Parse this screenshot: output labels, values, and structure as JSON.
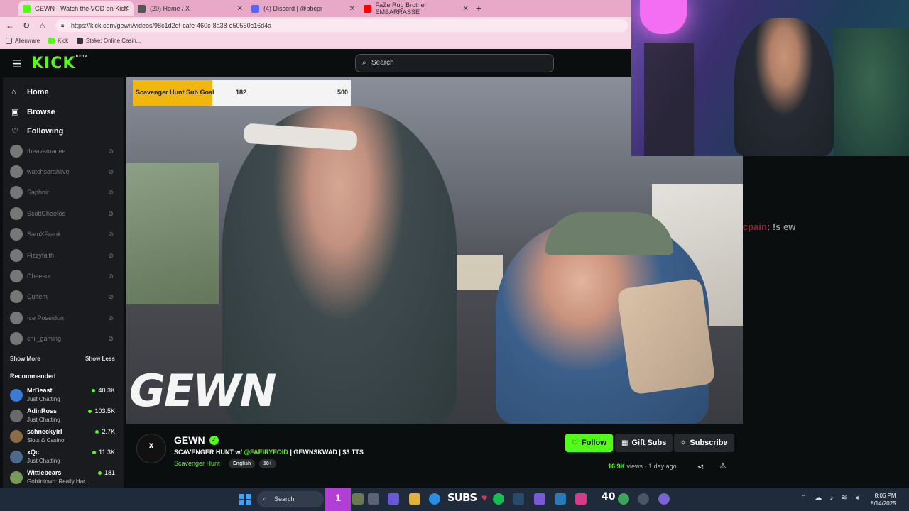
{
  "browser": {
    "tabs": [
      {
        "label": "GEWN - Watch the VOD on Kick",
        "fav_color": "#53fc18"
      },
      {
        "label": "(20) Home / X",
        "fav_color": "#555555"
      },
      {
        "label": "(4) Discord | @bbcpr",
        "fav_color": "#5865f2"
      },
      {
        "label": "FaZe Rug Brother EMBARRASSE",
        "fav_color": "#ff0000"
      }
    ],
    "url": "https://kick.com/gewn/videos/98c1d2ef-cafe-460c-8a38-e50550c16d4a",
    "bookmarks": [
      {
        "label": "Alienware"
      },
      {
        "label": "Kick"
      },
      {
        "label": "Stake: Online Casin..."
      }
    ]
  },
  "header": {
    "logo": "KICK",
    "logo_badge": "BETA",
    "search_placeholder": "Search"
  },
  "sidebar": {
    "nav": [
      {
        "label": "Home",
        "icon": "home-icon"
      },
      {
        "label": "Browse",
        "icon": "browse-icon"
      },
      {
        "label": "Following",
        "icon": "heart-icon"
      }
    ],
    "following": [
      "theavamariee",
      "watchsarahlive",
      "Saphnir",
      "ScottCheetos",
      "SamXFrank",
      "Fizzyfaith",
      "Cheesur",
      "Cuffem",
      "Ice Poseidon",
      "chii_gaming"
    ],
    "show_more": "Show More",
    "show_less": "Show Less",
    "recommended_title": "Recommended",
    "recommended": [
      {
        "name": "MrBeast",
        "category": "Just Chatting",
        "viewers": "40.3K",
        "color": "#3a7bd5"
      },
      {
        "name": "AdinRoss",
        "category": "Just Chatting",
        "viewers": "103.5K",
        "color": "#6a6a6a"
      },
      {
        "name": "schneckyirl",
        "category": "Slots & Casino",
        "viewers": "2.7K",
        "color": "#8b6d4c"
      },
      {
        "name": "xQc",
        "category": "Just Chatting",
        "viewers": "11.3K",
        "color": "#4c6a8b"
      },
      {
        "name": "Wittlebears",
        "category": "Goblintown: Really Har...",
        "viewers": "181",
        "color": "#7a9a5a"
      }
    ]
  },
  "video": {
    "watermark": "GEWN",
    "sub_goal": {
      "label": "Scavenger Hunt Sub Goal",
      "current": "182",
      "target": "500",
      "progress": 0.364
    }
  },
  "chat": {
    "user": "cpain",
    "message": ": !s ew"
  },
  "channel": {
    "avatar_text": "ᕁ",
    "name": "GEWN",
    "title_prefix": "SCAVENGER HUNT w/",
    "title_mention": "@FAEIRYFOID",
    "title_suffix": "| GEWNSKWAD | $3 TTS",
    "category": "Scavenger Hunt",
    "tags": [
      "English",
      "18+"
    ],
    "follow_label": "Follow",
    "gift_label": "Gift Subs",
    "subscribe_label": "Subscribe",
    "views": "16.9K",
    "views_word": "views",
    "age": "1 day ago"
  },
  "taskbar": {
    "search_label": "Search",
    "overlay_number": "1",
    "subs_label": "SUBS",
    "count": "40",
    "time": "8:06 PM",
    "date": "8/14/2025"
  }
}
